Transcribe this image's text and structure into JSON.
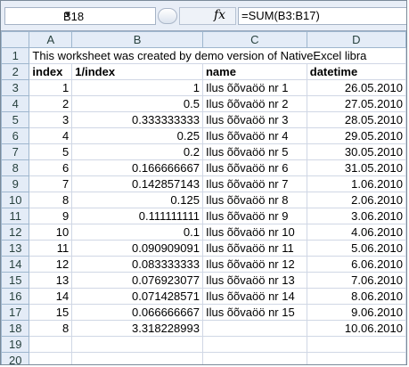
{
  "formula_bar": {
    "cell_ref": "B18",
    "dropdown_glyph": "▼",
    "fx_label": "fx",
    "formula": "=SUM(B3:B17)"
  },
  "columns": [
    "A",
    "B",
    "C",
    "D"
  ],
  "rows": [
    {
      "n": "1",
      "a": "This worksheet was created by demo version of NativeExcel libra",
      "b": "",
      "c": "",
      "d": ""
    },
    {
      "n": "2",
      "a": "index",
      "b": "1/index",
      "c": "name",
      "d": "datetime"
    },
    {
      "n": "3",
      "a": "1",
      "b": "1",
      "c": "Ilus õõvaöö nr 1",
      "d": "26.05.2010"
    },
    {
      "n": "4",
      "a": "2",
      "b": "0.5",
      "c": "Ilus õõvaöö nr 2",
      "d": "27.05.2010"
    },
    {
      "n": "5",
      "a": "3",
      "b": "0.333333333",
      "c": "Ilus õõvaöö nr 3",
      "d": "28.05.2010"
    },
    {
      "n": "6",
      "a": "4",
      "b": "0.25",
      "c": "Ilus õõvaöö nr 4",
      "d": "29.05.2010"
    },
    {
      "n": "7",
      "a": "5",
      "b": "0.2",
      "c": "Ilus õõvaöö nr 5",
      "d": "30.05.2010"
    },
    {
      "n": "8",
      "a": "6",
      "b": "0.166666667",
      "c": "Ilus õõvaöö nr 6",
      "d": "31.05.2010"
    },
    {
      "n": "9",
      "a": "7",
      "b": "0.142857143",
      "c": "Ilus õõvaöö nr 7",
      "d": "1.06.2010"
    },
    {
      "n": "10",
      "a": "8",
      "b": "0.125",
      "c": "Ilus õõvaöö nr 8",
      "d": "2.06.2010"
    },
    {
      "n": "11",
      "a": "9",
      "b": "0.111111111",
      "c": "Ilus õõvaöö nr 9",
      "d": "3.06.2010"
    },
    {
      "n": "12",
      "a": "10",
      "b": "0.1",
      "c": "Ilus õõvaöö nr 10",
      "d": "4.06.2010"
    },
    {
      "n": "13",
      "a": "11",
      "b": "0.090909091",
      "c": "Ilus õõvaöö nr 11",
      "d": "5.06.2010"
    },
    {
      "n": "14",
      "a": "12",
      "b": "0.083333333",
      "c": "Ilus õõvaöö nr 12",
      "d": "6.06.2010"
    },
    {
      "n": "15",
      "a": "13",
      "b": "0.076923077",
      "c": "Ilus õõvaöö nr 13",
      "d": "7.06.2010"
    },
    {
      "n": "16",
      "a": "14",
      "b": "0.071428571",
      "c": "Ilus õõvaöö nr 14",
      "d": "8.06.2010"
    },
    {
      "n": "17",
      "a": "15",
      "b": "0.066666667",
      "c": "Ilus õõvaöö nr 15",
      "d": "9.06.2010"
    },
    {
      "n": "18",
      "a": "8",
      "b": "3.318228993",
      "c": "",
      "d": "10.06.2010"
    },
    {
      "n": "19",
      "a": "",
      "b": "",
      "c": "",
      "d": ""
    },
    {
      "n": "20",
      "a": "",
      "b": "",
      "c": "",
      "d": ""
    }
  ]
}
